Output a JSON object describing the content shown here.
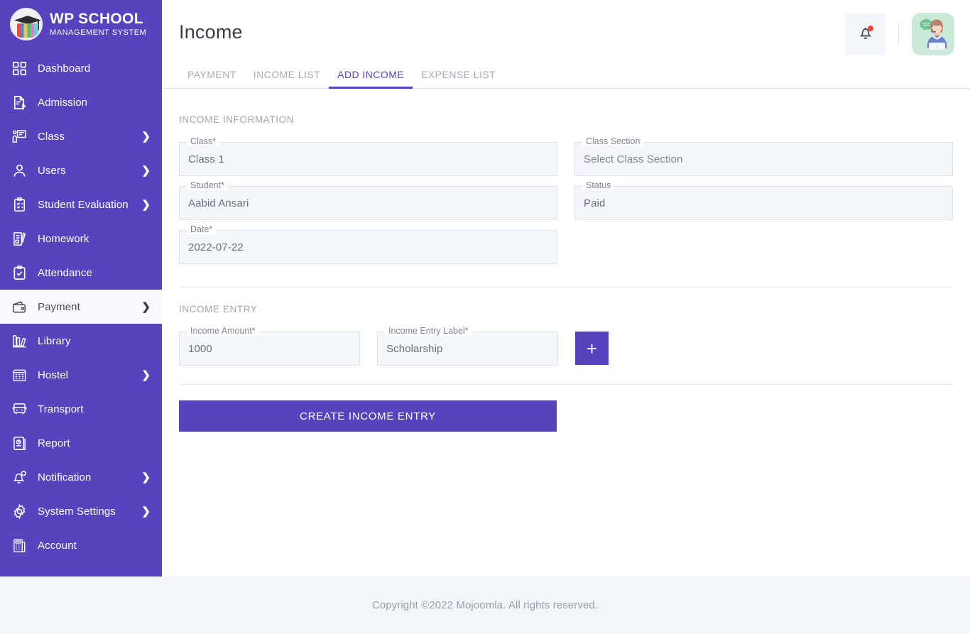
{
  "brand": {
    "title": "WP SCHOOL",
    "subtitle": "MANAGEMENT SYSTEM",
    "logo_icon": "graduation-cap-books-logo"
  },
  "sidebar": {
    "items": [
      {
        "label": "Dashboard",
        "icon": "grid-icon",
        "chevron": "",
        "active": false
      },
      {
        "label": "Admission",
        "icon": "document-pencil-icon",
        "chevron": "",
        "active": false
      },
      {
        "label": "Class",
        "icon": "classroom-icon",
        "chevron": "❯",
        "active": false
      },
      {
        "label": "Users",
        "icon": "user-icon",
        "chevron": "❯",
        "active": false
      },
      {
        "label": "Student Evaluation",
        "icon": "clipboard-check-icon",
        "chevron": "❯",
        "active": false
      },
      {
        "label": "Homework",
        "icon": "book-pencil-icon",
        "chevron": "",
        "active": false
      },
      {
        "label": "Attendance",
        "icon": "clipboard-tick-icon",
        "chevron": "",
        "active": false
      },
      {
        "label": "Payment",
        "icon": "wallet-icon",
        "chevron": "❯",
        "active": true
      },
      {
        "label": "Library",
        "icon": "books-icon",
        "chevron": "",
        "active": false
      },
      {
        "label": "Hostel",
        "icon": "building-icon",
        "chevron": "❯",
        "active": false
      },
      {
        "label": "Transport",
        "icon": "bus-icon",
        "chevron": "",
        "active": false
      },
      {
        "label": "Report",
        "icon": "report-icon",
        "chevron": "",
        "active": false
      },
      {
        "label": "Notification",
        "icon": "bell-alert-icon",
        "chevron": "❯",
        "active": false
      },
      {
        "label": "System Settings",
        "icon": "gear-icon",
        "chevron": "❯",
        "active": false
      },
      {
        "label": "Account",
        "icon": "calculator-icon",
        "chevron": "",
        "active": false
      }
    ]
  },
  "header": {
    "title": "Income",
    "bell_icon": "bell-icon",
    "has_notification_dot": true,
    "avatar_icon": "support-agent-avatar"
  },
  "tabs": [
    {
      "label": "PAYMENT",
      "active": false
    },
    {
      "label": "INCOME LIST",
      "active": false
    },
    {
      "label": "ADD INCOME",
      "active": true
    },
    {
      "label": "EXPENSE LIST",
      "active": false
    }
  ],
  "income_information": {
    "section_title": "INCOME INFORMATION",
    "fields": [
      {
        "label": "Class*",
        "value": "Class 1",
        "is_placeholder": false
      },
      {
        "label": "Class Section",
        "value": "Select Class Section",
        "is_placeholder": true
      },
      {
        "label": "Student*",
        "value": "Aabid Ansari",
        "is_placeholder": false
      },
      {
        "label": "Status",
        "value": "Paid",
        "is_placeholder": false
      },
      {
        "label": "Date*",
        "value": "2022-07-22",
        "is_placeholder": false
      }
    ]
  },
  "income_entry": {
    "section_title": "INCOME ENTRY",
    "amount": {
      "label": "Income Amount*",
      "value": "1000"
    },
    "entry_label": {
      "label": "Income Entry Label*",
      "value": "Scholarship"
    },
    "add_button": {
      "icon": "plus-icon",
      "label": "+"
    }
  },
  "submit": {
    "label": "CREATE INCOME ENTRY"
  },
  "footer": {
    "text": "Copyright ©2022 Mojoomla. All rights reserved."
  },
  "colors": {
    "brand_purple": "#5842bd",
    "field_bg": "#f3f6fb",
    "footer_bg": "#f2f5fa",
    "notification_dot": "#f0453a"
  }
}
